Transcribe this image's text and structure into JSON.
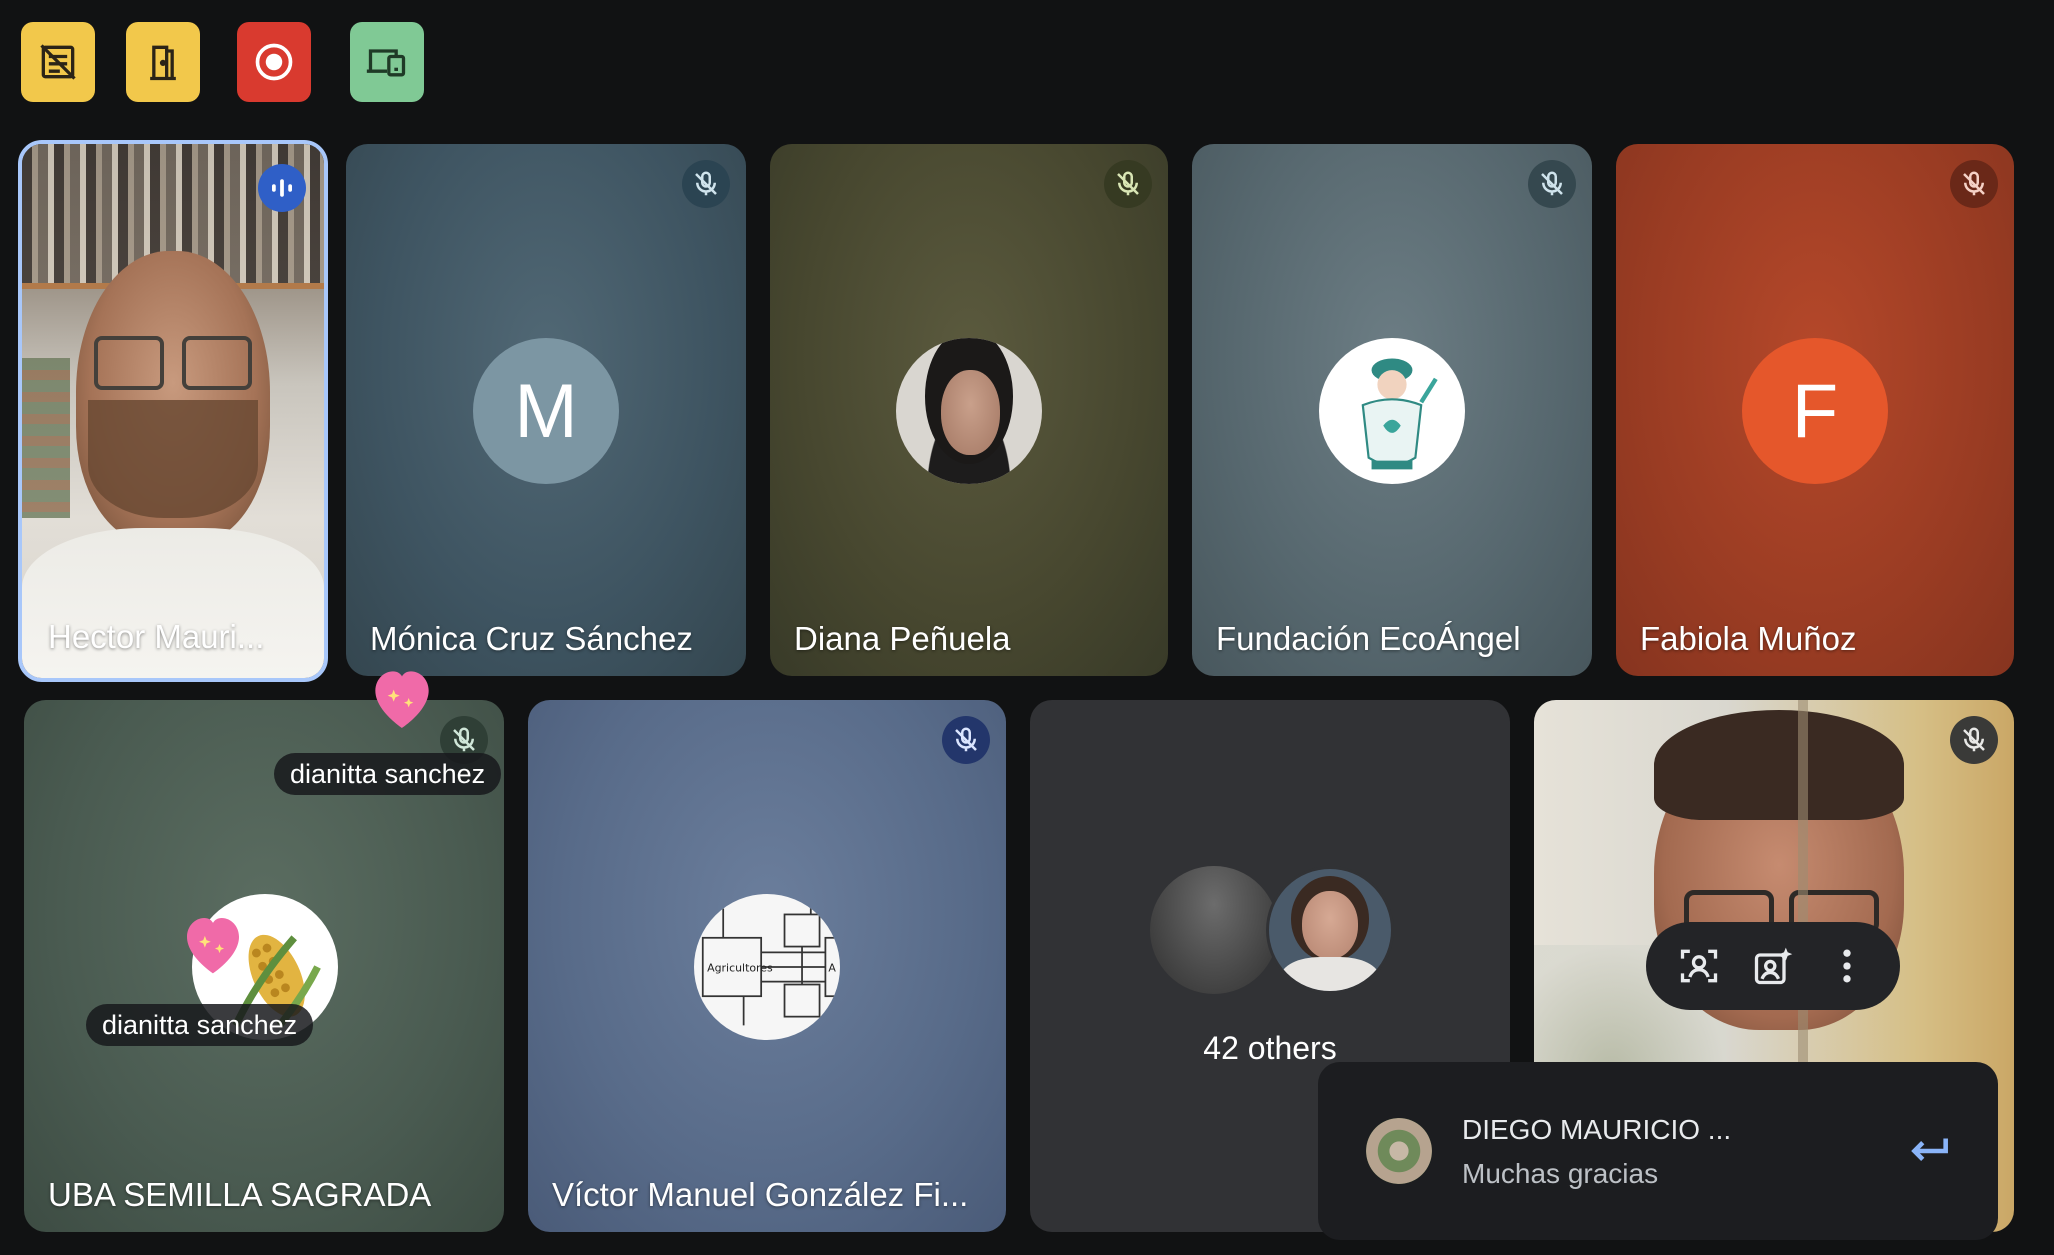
{
  "top_controls": [
    {
      "icon": "notes-off-icon",
      "color": "#f2c84b"
    },
    {
      "icon": "door-exit-icon",
      "color": "#f2c84b"
    },
    {
      "icon": "record-icon",
      "color": "#d93a2f"
    },
    {
      "icon": "device-cast-icon",
      "color": "#80c995"
    }
  ],
  "participants": {
    "hector": {
      "name": "Hector Mauri...",
      "status": "speaking-icon"
    },
    "monica": {
      "name": "Mónica Cruz Sánchez",
      "avatar_letter": "M",
      "avatar_color": "#7c96a3"
    },
    "diana": {
      "name": "Diana Peñuela"
    },
    "fundacion": {
      "name": "Fundación EcoÁngel"
    },
    "fabiola": {
      "name": "Fabiola Muñoz",
      "avatar_letter": "F",
      "avatar_color": "#e5572b"
    },
    "uba": {
      "name": "UBA SEMILLA SAGRADA"
    },
    "victor": {
      "name": "Víctor Manuel González Fi...",
      "avatar_text_1": "Agricultores",
      "avatar_text_2": "A"
    },
    "others": {
      "label": "42 others"
    }
  },
  "reactions": [
    {
      "user": "dianitta sanchez"
    },
    {
      "user": "dianitta sanchez"
    }
  ],
  "chat_notification": {
    "sender": "DIEGO MAURICIO ...",
    "message": "Muchas gracias"
  }
}
